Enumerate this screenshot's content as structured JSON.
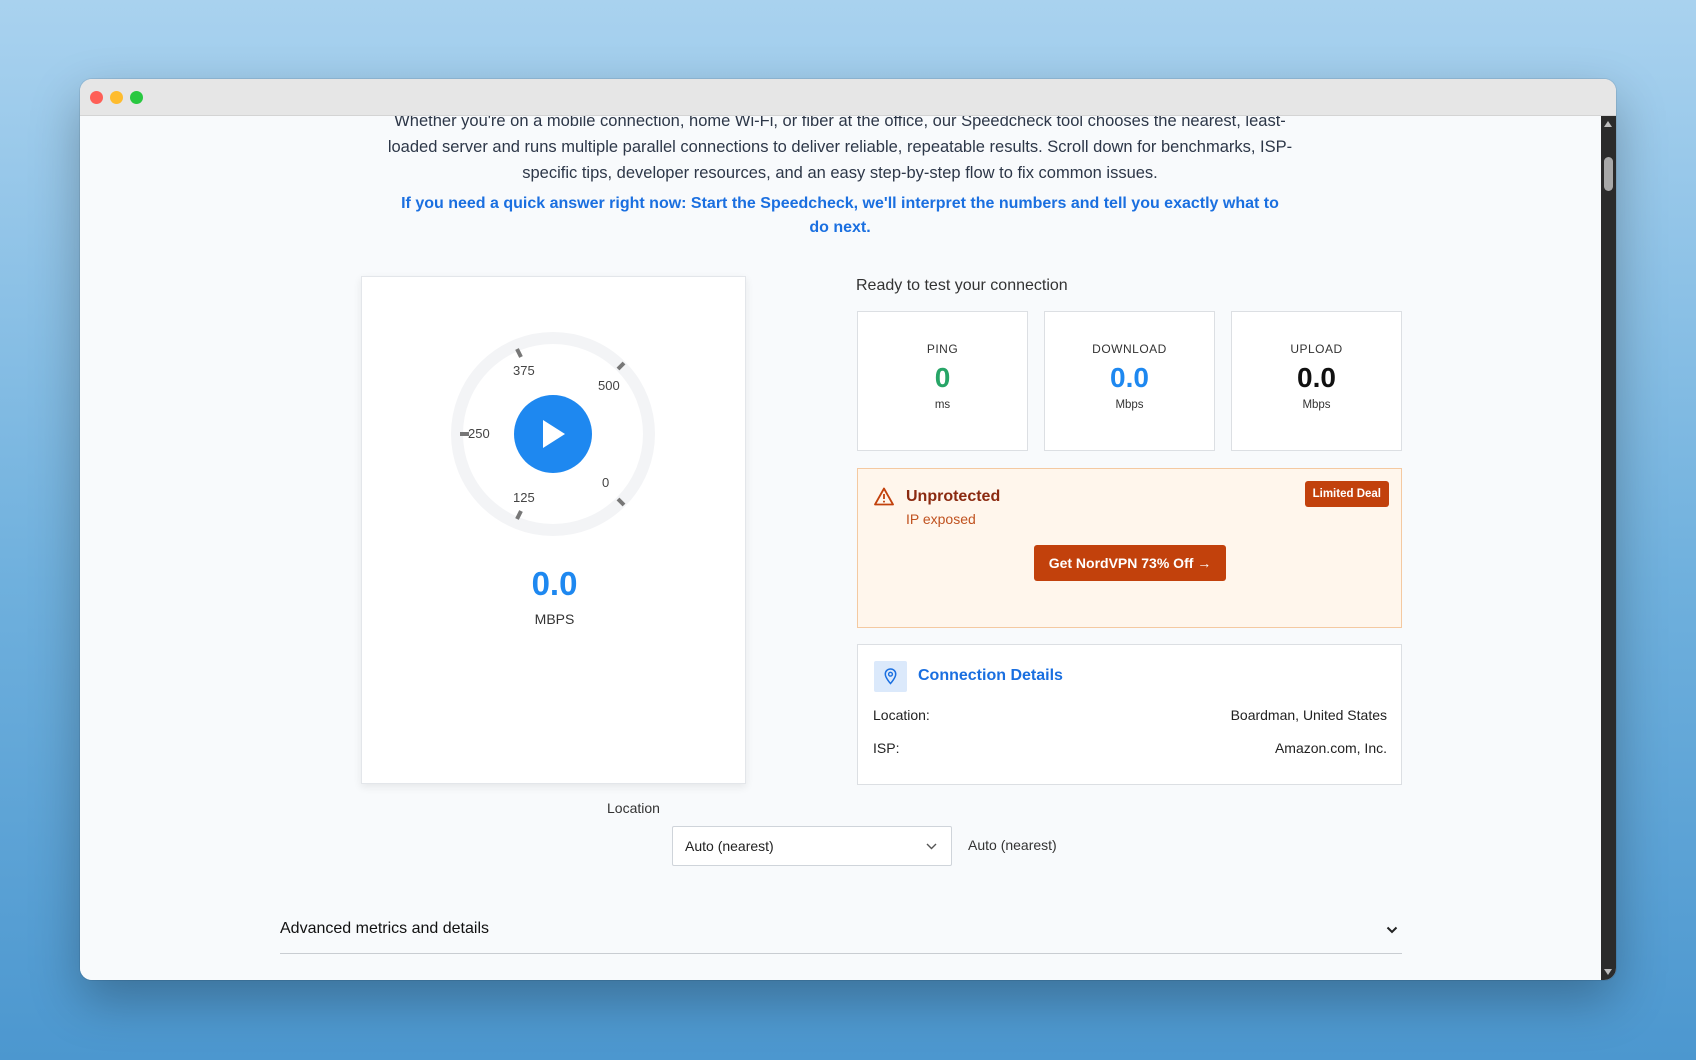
{
  "intro": {
    "paragraph": "Whether you're on a mobile connection, home Wi-Fi, or fiber at the office, our Speedcheck tool chooses the nearest, least-loaded server and runs multiple parallel connections to deliver reliable, repeatable results. Scroll down for benchmarks, ISP-specific tips, developer resources, and an easy step-by-step flow to fix common issues.",
    "quick_answer": "If you need a quick answer right now: Start the Speedcheck, we'll interpret the numbers and tell you exactly what to do next."
  },
  "gauge": {
    "ticks": [
      "0",
      "125",
      "250",
      "375",
      "500"
    ],
    "value": "0.0",
    "unit": "MBPS",
    "accent_color": "#1e88f0",
    "play_icon": "play-icon"
  },
  "status": {
    "ready_text": "Ready to test your connection"
  },
  "metrics": [
    {
      "label": "PING",
      "value": "0",
      "unit": "ms",
      "color": "#27a567"
    },
    {
      "label": "DOWNLOAD",
      "value": "0.0",
      "unit": "Mbps",
      "color": "#1e88f0"
    },
    {
      "label": "UPLOAD",
      "value": "0.0",
      "unit": "Mbps",
      "color": "#111111"
    }
  ],
  "vpn": {
    "title": "Unprotected",
    "subtitle": "IP exposed",
    "badge": "Limited Deal",
    "cta": "Get NordVPN 73% Off →",
    "icon": "warning-triangle-icon",
    "accent_color": "#c2410c"
  },
  "connection": {
    "title": "Connection Details",
    "icon": "location-pin-icon",
    "rows": [
      {
        "key": "Location:",
        "value": "Boardman, United States"
      },
      {
        "key": "ISP:",
        "value": "Amazon.com, Inc."
      }
    ]
  },
  "location_selector": {
    "label": "Location",
    "selected": "Auto (nearest)",
    "echo": "Auto (nearest)"
  },
  "advanced": {
    "label": "Advanced metrics and details"
  }
}
